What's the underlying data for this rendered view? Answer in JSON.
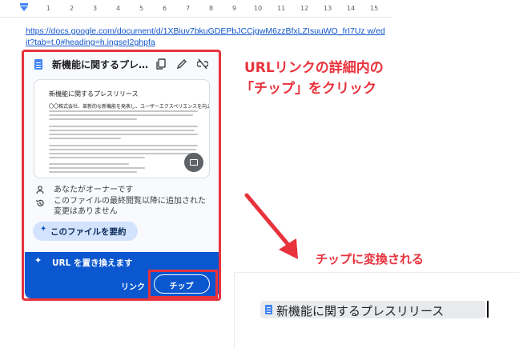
{
  "ruler": {
    "ticks": [
      "1",
      "2",
      "3",
      "4",
      "5",
      "6",
      "7",
      "8",
      "9",
      "10",
      "11",
      "12",
      "13",
      "14",
      "15"
    ]
  },
  "doc": {
    "url": "https://docs.google.com/document/d/1XBiuv7bkuGDEPbJCCjgwM6zzBfxLZIsuuWO_frI7Uz w/edit?tab=t.0#heading=h.ingseI2ghpfa"
  },
  "card": {
    "title": "新機能に関するプレ…",
    "icons": [
      "copy-icon",
      "pencil-icon",
      "unlink-icon"
    ],
    "preview": {
      "title": "新機能に関するプレスリリース",
      "subtitle": "〇〇株式会社、革新的な新機能を発表し、ユーザーエクスペリエンスを向上"
    },
    "owner_text": "あなたがオーナーです",
    "modified_text": "このファイルの最終閲覧以降に追加された変更はありません",
    "summarize_label": "このファイルを要約",
    "replace_label": "URL を置き換えます",
    "link_label": "リンク",
    "chip_label": "チップ"
  },
  "annotations": {
    "line1": "URLリンクの詳細内の",
    "line2": "「チップ」をクリック",
    "line3": "チップに変換される"
  },
  "result": {
    "chip_text": "新機能に関するプレスリリース"
  },
  "colors": {
    "accent_red": "#e8323c",
    "google_blue": "#0b57d0",
    "doc_blue": "#4285f4"
  }
}
